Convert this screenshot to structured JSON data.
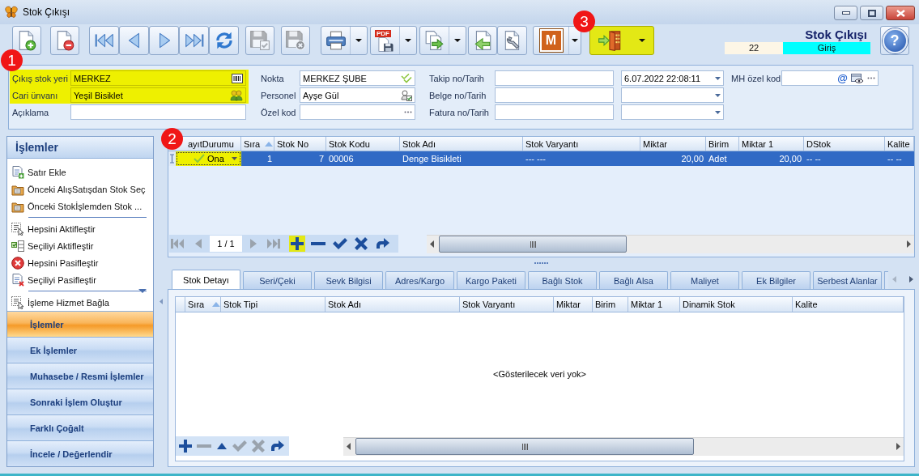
{
  "window": {
    "title": "Stok Çıkışı"
  },
  "toolbar": [
    {
      "kind": "new",
      "disabled": false,
      "dropdown": false,
      "highlighted": false
    },
    {
      "kind": "delete",
      "disabled": false,
      "dropdown": false,
      "highlighted": false
    },
    {
      "kind": "first",
      "disabled": false,
      "dropdown": false,
      "highlighted": false
    },
    {
      "kind": "previous",
      "disabled": false,
      "dropdown": false,
      "highlighted": false
    },
    {
      "kind": "next",
      "disabled": false,
      "dropdown": false,
      "highlighted": false
    },
    {
      "kind": "last",
      "disabled": false,
      "dropdown": false,
      "highlighted": false
    },
    {
      "kind": "refresh",
      "disabled": false,
      "dropdown": false,
      "highlighted": false
    },
    {
      "kind": "save",
      "disabled": true,
      "dropdown": false,
      "highlighted": false
    },
    {
      "kind": "discard",
      "disabled": true,
      "dropdown": false,
      "highlighted": false
    },
    {
      "kind": "print",
      "disabled": false,
      "dropdown": true,
      "highlighted": false
    },
    {
      "kind": "pdf",
      "label": "PDF",
      "disabled": false,
      "dropdown": true,
      "highlighted": false
    },
    {
      "kind": "transfer",
      "disabled": false,
      "dropdown": true,
      "highlighted": false
    },
    {
      "kind": "import",
      "disabled": false,
      "dropdown": false,
      "highlighted": false
    },
    {
      "kind": "tools",
      "disabled": false,
      "dropdown": false,
      "highlighted": false
    },
    {
      "kind": "module",
      "label": "M",
      "disabled": false,
      "dropdown": true,
      "highlighted": false
    },
    {
      "kind": "exit",
      "disabled": false,
      "dropdown": true,
      "highlighted": true,
      "badge": "3"
    }
  ],
  "header": {
    "title": "Stok Çıkışı",
    "number": "22",
    "direction": "Giriş",
    "help": "?"
  },
  "form": {
    "badge": "1",
    "columns": [
      {
        "fields": [
          {
            "label": "Çıkış stok yeri",
            "value": "MERKEZ",
            "kind": "location",
            "highlighted": true
          },
          {
            "label": "Cari ünvanı",
            "value": "Yeşil Bisiklet",
            "kind": "account",
            "highlighted": true
          },
          {
            "label": "Açıklama",
            "kind": "text",
            "highlighted": false
          }
        ]
      },
      {
        "fields": [
          {
            "label": "Nokta",
            "value": "MERKEZ ŞUBE",
            "kind": "branch",
            "highlighted": false
          },
          {
            "label": "Personel",
            "value": "Ayşe Gül",
            "kind": "staff",
            "highlighted": false
          },
          {
            "label": "Özel kod",
            "kind": "more",
            "highlighted": false
          }
        ]
      },
      {
        "fields": [
          {
            "label": "Takip no/Tarih",
            "kind": "number-date",
            "date": "6.07.2022 22:08:11",
            "highlighted": false
          },
          {
            "label": "Belge no/Tarih",
            "kind": "number-date",
            "highlighted": false
          },
          {
            "label": "Fatura no/Tarih",
            "kind": "number-date",
            "highlighted": false
          }
        ]
      },
      {
        "fields": [
          {
            "label": "MH özel kod",
            "kind": "special",
            "symbol": "@",
            "highlighted": false
          }
        ]
      }
    ]
  },
  "sidebar": {
    "title": "İşlemler",
    "groups": [
      {
        "items": [
          {
            "label": "Satır Ekle",
            "kind": "add"
          },
          {
            "label": "Önceki AlışSatışdan Stok Seç",
            "kind": "from-sale"
          },
          {
            "label": "Önceki Stokİşlemden Stok ...",
            "kind": "from-stock"
          }
        ]
      },
      {
        "items": [
          {
            "label": "Hepsini Aktifleştir",
            "kind": "activate-all"
          },
          {
            "label": "Seçiliyi Aktifleştir",
            "kind": "activate-one"
          },
          {
            "label": "Hepsini Pasifleştir",
            "kind": "deactivate-all"
          },
          {
            "label": "Seçiliyi Pasifleştir",
            "kind": "deactivate-one"
          }
        ]
      },
      {
        "items": [
          {
            "label": "İşleme Hizmet Bağla",
            "kind": "link"
          }
        ]
      }
    ],
    "sections": [
      {
        "label": "İşlemler",
        "selected": true
      },
      {
        "label": "Ek İşlemler",
        "selected": false
      },
      {
        "label": "Muhasebe / Resmi İşlemler",
        "selected": false
      },
      {
        "label": "Sonraki İşlem Oluştur",
        "selected": false
      },
      {
        "label": "Farklı Çoğalt",
        "selected": false
      },
      {
        "label": "İncele / Değerlendir",
        "selected": false
      }
    ]
  },
  "grid": {
    "badge": "2",
    "columns": [
      {
        "label": "ayıtDurumu",
        "kind": "status",
        "sorted": false
      },
      {
        "label": "Sıra",
        "kind": "number",
        "sorted": true
      },
      {
        "label": "Stok No",
        "kind": "number",
        "sorted": false
      },
      {
        "label": "Stok Kodu",
        "kind": "text",
        "sorted": false
      },
      {
        "label": "Stok Adı",
        "kind": "text",
        "sorted": false
      },
      {
        "label": "Stok Varyantı",
        "kind": "text",
        "sorted": false
      },
      {
        "label": "Miktar",
        "kind": "number",
        "sorted": false
      },
      {
        "label": "Birim",
        "kind": "text",
        "sorted": false
      },
      {
        "label": "Miktar 1",
        "kind": "number",
        "sorted": false
      },
      {
        "label": "DStok",
        "kind": "text",
        "sorted": false
      },
      {
        "label": "Kalite",
        "kind": "text",
        "sorted": false
      }
    ],
    "rows": [
      {
        "selected": true,
        "cells": [
          {
            "text": "Ona",
            "highlighted": true
          },
          {
            "text": "1",
            "highlighted": false
          },
          {
            "text": "7",
            "highlighted": false
          },
          {
            "text": "00006",
            "highlighted": false
          },
          {
            "text": "Denge Bisikleti",
            "highlighted": false
          },
          {
            "text": "--- ---",
            "highlighted": false
          },
          {
            "text": "20,00",
            "highlighted": false
          },
          {
            "text": "Adet",
            "highlighted": false
          },
          {
            "text": "20,00",
            "highlighted": false
          },
          {
            "text": "-- --",
            "highlighted": false
          },
          {
            "text": "-- --",
            "highlighted": false
          }
        ]
      }
    ],
    "pager": "1 / 1",
    "tools": [
      {
        "kind": "first",
        "disabled": true,
        "highlighted": false
      },
      {
        "kind": "previous",
        "disabled": true,
        "highlighted": false
      },
      {
        "kind": "next",
        "disabled": true,
        "highlighted": false
      },
      {
        "kind": "last",
        "disabled": true,
        "highlighted": false
      },
      {
        "kind": "add",
        "disabled": false,
        "highlighted": true
      },
      {
        "kind": "remove",
        "disabled": false,
        "highlighted": false
      },
      {
        "kind": "confirm",
        "disabled": false,
        "highlighted": false
      },
      {
        "kind": "cancel",
        "disabled": false,
        "highlighted": false
      },
      {
        "kind": "redo",
        "disabled": false,
        "highlighted": false
      }
    ]
  },
  "detail": {
    "tabs": [
      {
        "label": "Stok Detayı",
        "selected": true
      },
      {
        "label": "Seri/Çeki",
        "selected": false
      },
      {
        "label": "Sevk Bilgisi",
        "selected": false
      },
      {
        "label": "Adres/Kargo",
        "selected": false
      },
      {
        "label": "Kargo Paketi",
        "selected": false
      },
      {
        "label": "Bağlı Stok",
        "selected": false
      },
      {
        "label": "Bağlı Alsa",
        "selected": false
      },
      {
        "label": "Maliyet",
        "selected": false
      },
      {
        "label": "Ek Bilgiler",
        "selected": false
      },
      {
        "label": "Serbest Alanlar",
        "selected": false
      }
    ],
    "columns": [
      {
        "label": "Sıra",
        "sorted": true
      },
      {
        "label": "Stok Tipi",
        "sorted": false
      },
      {
        "label": "Stok Adı",
        "sorted": false
      },
      {
        "label": "Stok Varyantı",
        "sorted": false
      },
      {
        "label": "Miktar",
        "sorted": false
      },
      {
        "label": "Birim",
        "sorted": false
      },
      {
        "label": "Miktar 1",
        "sorted": false
      },
      {
        "label": "Dinamik Stok",
        "sorted": false
      },
      {
        "label": "Kalite",
        "sorted": false
      }
    ],
    "empty_text": "<Gösterilecek veri yok>",
    "tools": [
      {
        "kind": "add",
        "disabled": false
      },
      {
        "kind": "remove",
        "disabled": true
      },
      {
        "kind": "up",
        "disabled": false
      },
      {
        "kind": "confirm",
        "disabled": true
      },
      {
        "kind": "cancel",
        "disabled": true
      },
      {
        "kind": "redo",
        "disabled": false
      }
    ]
  }
}
